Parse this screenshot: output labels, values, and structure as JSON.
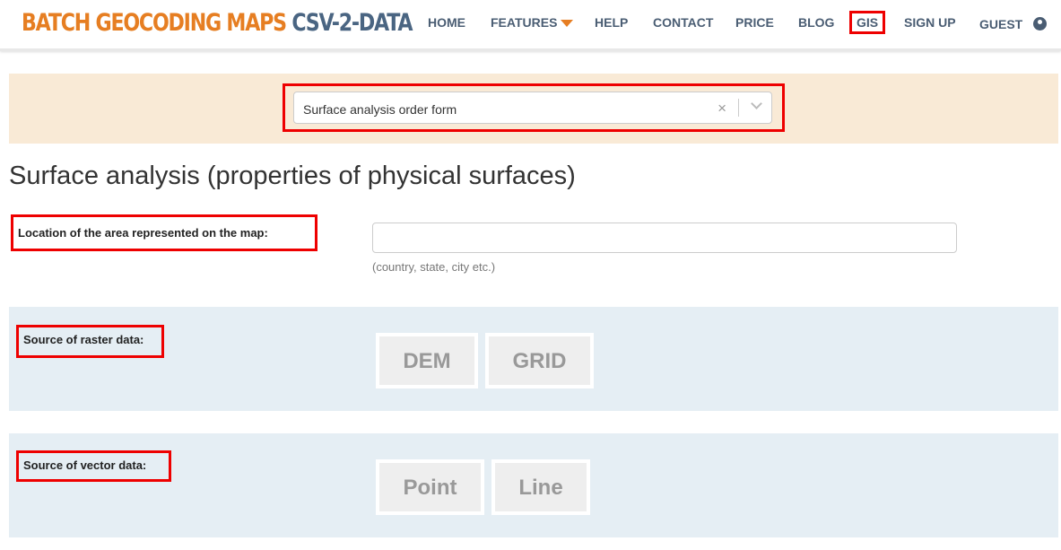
{
  "header": {
    "logo_primary": "BATCH GEOCODING MAPS",
    "logo_secondary": "CSV-2-DATA",
    "nav": [
      "HOME",
      "FEATURES",
      "HELP",
      "CONTACT",
      "PRICE",
      "BLOG",
      "GIS",
      "SIGN UP",
      "GUEST"
    ]
  },
  "selector": {
    "value": "Surface analysis order form",
    "clear": "×"
  },
  "page_title": "Surface analysis (properties of physical surfaces)",
  "location": {
    "label": "Location of the area represented on the map:",
    "value": "",
    "hint": "(country, state, city etc.)"
  },
  "raster": {
    "label": "Source of raster data:",
    "options": [
      "DEM",
      "GRID"
    ]
  },
  "vector": {
    "label": "Source of vector data:",
    "options": [
      "Point",
      "Line"
    ]
  },
  "colors": {
    "brand_orange": "#e67e22",
    "brand_blue": "#4a6582",
    "highlight": "#ee0000"
  }
}
